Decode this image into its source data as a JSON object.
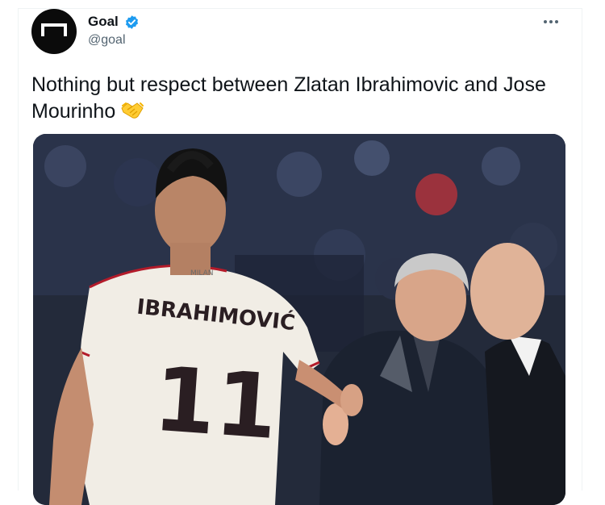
{
  "account": {
    "display_name": "Goal",
    "handle": "@goal",
    "verified": true,
    "avatar_icon": "goal-logo-icon"
  },
  "menu": {
    "icon": "more-horizontal-icon"
  },
  "tweet": {
    "text": "Nothing but respect between Zlatan Ibrahimovic and Jose Mourinho",
    "emoji_icon": "handshake-emoji-icon"
  },
  "media": {
    "jersey_name": "IBRAHIMOVIĆ",
    "jersey_number": "11",
    "jersey_brand": "MILAN"
  },
  "colors": {
    "verified": "#1d9bf0",
    "handle": "#536471",
    "text": "#0f1419"
  }
}
